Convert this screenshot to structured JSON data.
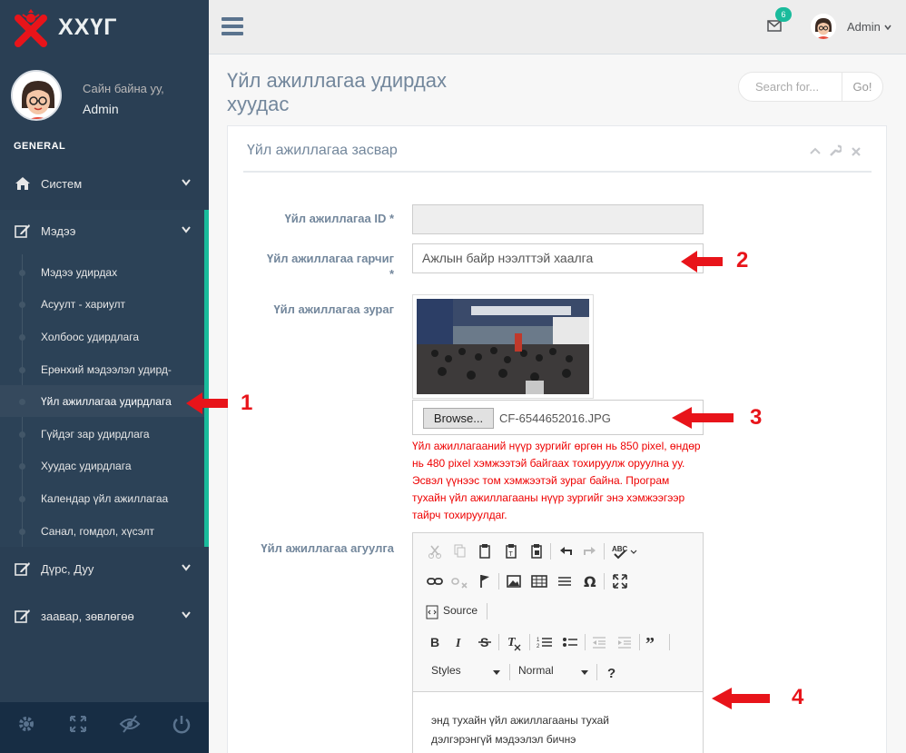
{
  "brand": {
    "name": "ХХҮГ"
  },
  "profile": {
    "greeting": "Сайн байна уу,",
    "name": "Admin"
  },
  "sidebar": {
    "section_title": "GENERAL",
    "items": [
      {
        "label": "Систем",
        "icon": "home-icon"
      },
      {
        "label": "Мэдээ",
        "icon": "edit-icon"
      },
      {
        "label": "Дүрс, Дуу",
        "icon": "edit-icon"
      },
      {
        "label": "заавар, зөвлөгөө",
        "icon": "edit-icon"
      }
    ],
    "submenu": [
      "Мэдээ удирдах",
      "Асуулт - хариулт",
      "Холбоос удирдлага",
      "Ерөнхий мэдээлэл удирд-",
      "Үйл ажиллагаа удирдлага",
      "Гүйдэг зар удирдлага",
      "Хуудас удирдлага",
      "Календар үйл ажиллагаа",
      "Санал, гомдол, хүсэлт"
    ],
    "footer_icons": [
      "gear-icon",
      "fullscreen-icon",
      "eye-slash-icon",
      "power-icon"
    ]
  },
  "topnav": {
    "mail_count": "6",
    "user": "Admin"
  },
  "page": {
    "title": "Үйл ажиллагаа удирдах хуудас",
    "search_placeholder": "Search for...",
    "search_button": "Go!"
  },
  "panel": {
    "title": "Үйл ажиллагаа засвар",
    "labels": {
      "id": "Үйл ажиллагаа ID *",
      "title_line1": "Үйл ажиллагаа гарчиг",
      "title_line2": "*",
      "image": "Үйл ажиллагаа зураг",
      "content": "Үйл ажиллагаа агуулга"
    },
    "title_value": "Ажлын байр нээлттэй хаалга",
    "browse_label": "Browse...",
    "file_name": "CF-6544652016.JPG",
    "image_help": "Үйл ажиллагааний нүүр зургийг өргөн нь 850 pixel, өндөр нь 480 pixel хэмжээтэй байгаах тохируулж оруулна уу. Эсвэл үүнээс том хэмжээтэй зураг байна. Програм тухайн үйл ажиллагааны нүүр зургийг энэ хэмжээгээр тайрч тохируулдаг.",
    "editor": {
      "source_label": "Source",
      "styles_label": "Styles",
      "format_label": "Normal",
      "body_line1": "энд тухайн үйл ажиллагааны тухай",
      "body_line2": "дэлгэрэнгүй мэдээлэл бичнэ"
    }
  },
  "annotations": [
    "1",
    "2",
    "3",
    "4"
  ],
  "colors": {
    "sidebar": "#2a3f54",
    "accent": "#1abb9c",
    "annotation_red": "#e8141a",
    "help_red": "#ee0000"
  }
}
